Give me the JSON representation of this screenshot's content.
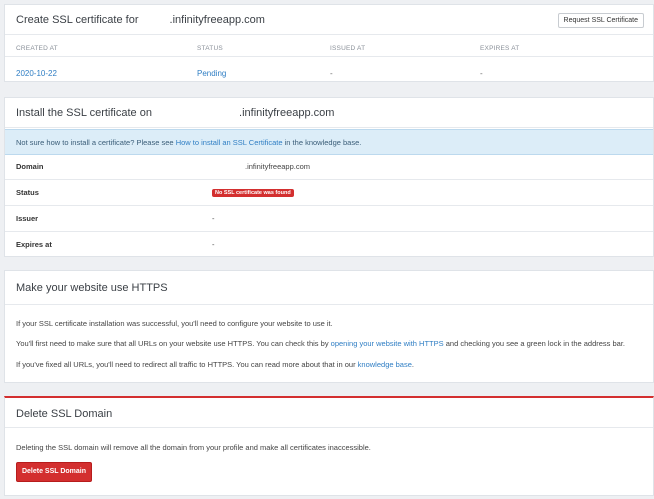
{
  "request_card": {
    "title_prefix": "Create SSL certificate for",
    "title_domain": ".infinityfreeapp.com",
    "request_button": "Request SSL Certificate",
    "columns": [
      "CREATED AT",
      "STATUS",
      "ISSUED AT",
      "EXPIRES AT"
    ],
    "row": {
      "created_at": "2020-10-22",
      "status": "Pending",
      "issued_at": "-",
      "expires_at": "-"
    }
  },
  "install_card": {
    "title_prefix": "Install the SSL certificate on",
    "title_domain": ".infinityfreeapp.com",
    "info_prefix": "Not sure how to install a certificate? Please see",
    "info_link": "How to install an SSL Certificate",
    "info_suffix": "in the knowledge base.",
    "rows": {
      "domain_label": "Domain",
      "domain_value": ".infinityfreeapp.com",
      "status_label": "Status",
      "status_badge": "No SSL certificate was found",
      "issuer_label": "Issuer",
      "issuer_value": "-",
      "expires_label": "Expires at",
      "expires_value": "-"
    }
  },
  "https_card": {
    "title": "Make your website use HTTPS",
    "p1": "If your SSL certificate installation was successful, you'll need to configure your website to use it.",
    "p2_prefix": "You'll first need to make sure that all URLs on your website use HTTPS. You can check this by",
    "p2_link": "opening your website with HTTPS",
    "p2_suffix": "and checking you see a green lock in the address bar.",
    "p3_prefix": "If you've fixed all URLs, you'll need to redirect all traffic to HTTPS. You can read more about that in our",
    "p3_link": "knowledge base",
    "p3_suffix": "."
  },
  "delete_card": {
    "title": "Delete SSL Domain",
    "text": "Deleting the SSL domain will remove all the domain from your profile and make all certificates inaccessible.",
    "button": "Delete SSL Domain"
  },
  "colors": {
    "accent": "#2f7ec4",
    "danger": "#d32f2f",
    "info_bg": "#dcedf8"
  }
}
